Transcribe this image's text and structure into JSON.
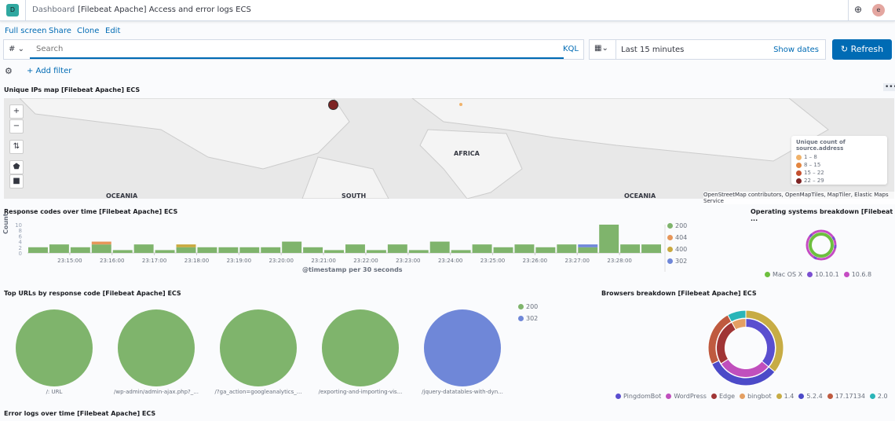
{
  "header": {
    "logo_letter": "D",
    "breadcrumb_root": "Dashboard",
    "breadcrumb_current": "[Filebeat Apache] Access and error logs ECS",
    "user_initial": "e"
  },
  "actions": {
    "full_screen": "Full screen",
    "share": "Share",
    "clone": "Clone",
    "edit": "Edit"
  },
  "query": {
    "lang_symbol": "#",
    "placeholder": "Search",
    "kql": "KQL",
    "time_range": "Last 15 minutes",
    "show_dates": "Show dates",
    "refresh": "Refresh",
    "add_filter": "+ Add filter"
  },
  "map": {
    "title": "Unique IPs map [Filebeat Apache] ECS",
    "labels": [
      "AFRICA",
      "OCEANIA",
      "SOUTH",
      "OCEANIA"
    ],
    "legend_title": "Unique count of source.address",
    "legend": [
      {
        "label": "1 – 8",
        "color": "#f0b26a"
      },
      {
        "label": "8 – 15",
        "color": "#e3853f"
      },
      {
        "label": "15 – 22",
        "color": "#c4502f"
      },
      {
        "label": "22 – 29",
        "color": "#7d2424"
      }
    ],
    "attribution": "OpenStreetMap contributors, OpenMapTiles, MapTiler, Elastic Maps Service"
  },
  "chart_data": [
    {
      "type": "bar",
      "stacked": true,
      "title": "Response codes over time [Filebeat Apache] ECS",
      "xlabel": "@timestamp per 30 seconds",
      "ylabel": "Count",
      "ylim": [
        0,
        10
      ],
      "yticks": [
        "10",
        "8",
        "6",
        "4",
        "2",
        "0"
      ],
      "xticks": [
        "23:15:00",
        "23:16:00",
        "23:17:00",
        "23:18:00",
        "23:19:00",
        "23:20:00",
        "23:21:00",
        "23:22:00",
        "23:23:00",
        "23:24:00",
        "23:25:00",
        "23:26:00",
        "23:27:00",
        "23:28:00"
      ],
      "series": [
        {
          "name": "200",
          "color": "#7fb46c",
          "values": [
            2,
            3,
            2,
            3,
            1,
            3,
            1,
            2,
            2,
            2,
            2,
            2,
            4,
            2,
            1,
            3,
            1,
            3,
            1,
            4,
            1,
            3,
            2,
            3,
            2,
            3,
            2,
            10,
            3,
            3
          ]
        },
        {
          "name": "404",
          "color": "#e7965a",
          "values": [
            0,
            0,
            0,
            1,
            0,
            0,
            0,
            0,
            0,
            0,
            0,
            0,
            0,
            0,
            0,
            0,
            0,
            0,
            0,
            0,
            0,
            0,
            0,
            0,
            0,
            0,
            0,
            0,
            0,
            0
          ]
        },
        {
          "name": "400",
          "color": "#c9a93f",
          "values": [
            0,
            0,
            0,
            0,
            0,
            0,
            0,
            1,
            0,
            0,
            0,
            0,
            0,
            0,
            0,
            0,
            0,
            0,
            0,
            0,
            0,
            0,
            0,
            0,
            0,
            0,
            0,
            0,
            0,
            0
          ]
        },
        {
          "name": "302",
          "color": "#6f87d8",
          "values": [
            0,
            0,
            0,
            0,
            0,
            0,
            0,
            0,
            0,
            0,
            0,
            0,
            0,
            0,
            0,
            0,
            0,
            0,
            0,
            0,
            0,
            0,
            0,
            0,
            0,
            0,
            1,
            0,
            0,
            0
          ]
        }
      ]
    },
    {
      "type": "pie",
      "title": "Operating systems breakdown [Filebeat ...",
      "legend": [
        {
          "name": "Mac OS X",
          "color": "#6dbf3e"
        },
        {
          "name": "10.10.1",
          "color": "#7b4fd1"
        },
        {
          "name": "10.6.8",
          "color": "#c54cc3"
        }
      ]
    },
    {
      "type": "pie",
      "title": "Top URLs by response code [Filebeat Apache] ECS",
      "legend": [
        {
          "name": "200",
          "color": "#7fb46c"
        },
        {
          "name": "302",
          "color": "#6f87d8"
        }
      ],
      "pies": [
        {
          "label": "/: URL",
          "color": "#7fb46c"
        },
        {
          "label": "/wp-admin/admin-ajax.php?_...",
          "color": "#7fb46c"
        },
        {
          "label": "/?ga_action=googleanalytics_...",
          "color": "#7fb46c"
        },
        {
          "label": "/exporting-and-importing-vis...",
          "color": "#7fb46c"
        },
        {
          "label": "/jquery-datatables-with-dyn...",
          "color": "#6f87d8"
        }
      ]
    },
    {
      "type": "pie",
      "title": "Browsers breakdown [Filebeat Apache] ECS",
      "inner": [
        {
          "name": "PingdomBot",
          "value": 36,
          "color": "#5a4ecf"
        },
        {
          "name": "WordPress",
          "value": 30,
          "color": "#c04fbd"
        },
        {
          "name": "Edge",
          "value": 26,
          "color": "#a03535"
        },
        {
          "name": "bingbot",
          "value": 8,
          "color": "#e49f62"
        }
      ],
      "outer": [
        {
          "name": "1.4",
          "value": 36,
          "color": "#c7ac45"
        },
        {
          "name": "5.2.4",
          "value": 32,
          "color": "#4c4ac8"
        },
        {
          "name": "17.17134",
          "value": 24,
          "color": "#bf5a3f"
        },
        {
          "name": "2.0",
          "value": 8,
          "color": "#2ab5b8"
        }
      ]
    }
  ],
  "bottom": {
    "error_title": "Error logs over time [Filebeat Apache] ECS"
  }
}
